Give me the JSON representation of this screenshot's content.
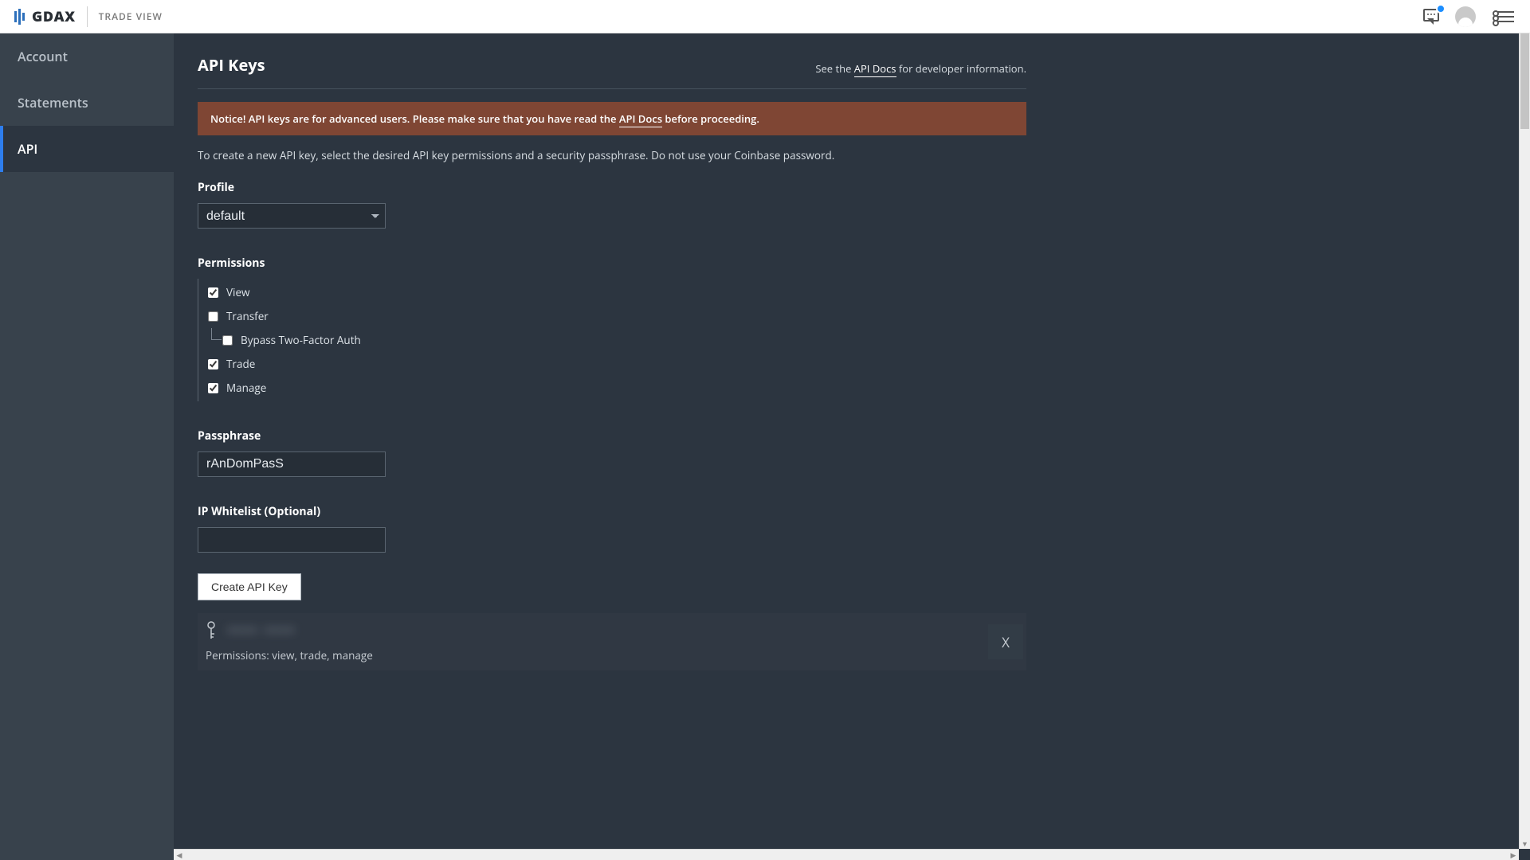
{
  "topbar": {
    "brand": "GDAX",
    "nav_link": "TRADE VIEW"
  },
  "sidebar": {
    "items": [
      {
        "label": "Account",
        "active": false
      },
      {
        "label": "Statements",
        "active": false
      },
      {
        "label": "API",
        "active": true
      }
    ]
  },
  "page": {
    "title": "API Keys",
    "docs_hint_before": "See the ",
    "docs_hint_link": "API Docs",
    "docs_hint_after": " for developer information.",
    "notice_before": "Notice! API keys are for advanced users. Please make sure that you have read the ",
    "notice_link": "API Docs",
    "notice_after": " before proceeding.",
    "intro": "To create a new API key, select the desired API key permissions and a security passphrase. Do not use your Coinbase password."
  },
  "form": {
    "profile_label": "Profile",
    "profile_value": "default",
    "permissions_label": "Permissions",
    "permissions": {
      "view": {
        "label": "View",
        "checked": true
      },
      "transfer": {
        "label": "Transfer",
        "checked": false
      },
      "bypass2fa": {
        "label": "Bypass Two-Factor Auth",
        "checked": false
      },
      "trade": {
        "label": "Trade",
        "checked": true
      },
      "manage": {
        "label": "Manage",
        "checked": true
      }
    },
    "passphrase_label": "Passphrase",
    "passphrase_value": "rAnDomPasS",
    "whitelist_label": "IP Whitelist (Optional)",
    "whitelist_value": "",
    "submit_label": "Create API Key"
  },
  "existing_key": {
    "masked_key": "•••• ••••",
    "permissions_text": "Permissions: view, trade, manage",
    "delete_label": "X"
  }
}
